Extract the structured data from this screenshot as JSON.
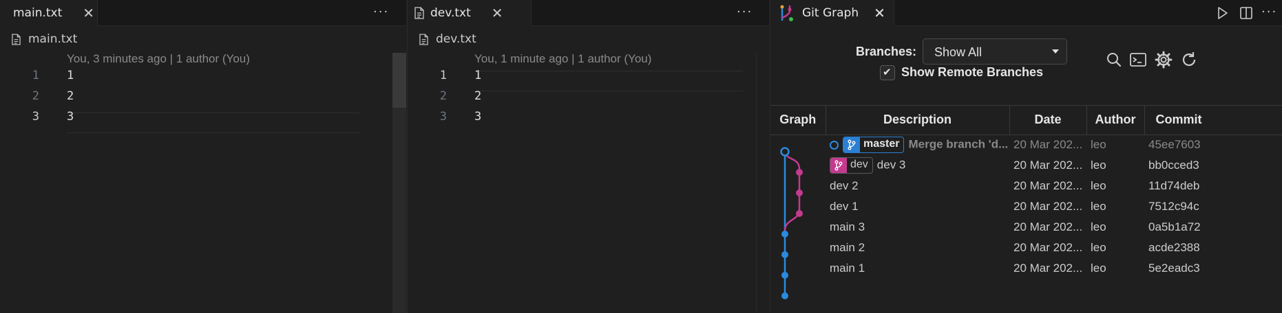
{
  "editors": [
    {
      "tab": "main.txt",
      "breadcrumb": "main.txt",
      "blame": "You, 3 minutes ago | 1 author (You)",
      "lines": [
        {
          "num": "1",
          "code": "1"
        },
        {
          "num": "2",
          "code": "2"
        },
        {
          "num": "3",
          "code": "3"
        }
      ],
      "active_line": 3
    },
    {
      "tab": "dev.txt",
      "breadcrumb": "dev.txt",
      "blame": "You, 1 minute ago | 1 author (You)",
      "lines": [
        {
          "num": "1",
          "code": "1"
        },
        {
          "num": "2",
          "code": "2"
        },
        {
          "num": "3",
          "code": "3"
        }
      ],
      "active_line": 1
    }
  ],
  "more_label": "···",
  "close_glyph": "✕",
  "git_graph": {
    "tab": "Git Graph",
    "branches_label": "Branches:",
    "branches_value": "Show All",
    "show_remote_label": "Show Remote Branches",
    "show_remote_checked": true,
    "check_glyph": "✔",
    "columns": [
      "Graph",
      "Description",
      "Date",
      "Author",
      "Commit"
    ],
    "commits": [
      {
        "refs": [
          "master"
        ],
        "head": true,
        "desc": "Merge branch 'd...",
        "date": "20 Mar 202...",
        "author": "leo",
        "hash": "45ee7603",
        "uncommitted_style": true
      },
      {
        "refs": [
          "dev"
        ],
        "head": false,
        "desc": "dev 3",
        "date": "20 Mar 202...",
        "author": "leo",
        "hash": "bb0cced3"
      },
      {
        "refs": [],
        "head": false,
        "desc": "dev 2",
        "date": "20 Mar 202...",
        "author": "leo",
        "hash": "11d74deb"
      },
      {
        "refs": [],
        "head": false,
        "desc": "dev 1",
        "date": "20 Mar 202...",
        "author": "leo",
        "hash": "7512c94c"
      },
      {
        "refs": [],
        "head": false,
        "desc": "main 3",
        "date": "20 Mar 202...",
        "author": "leo",
        "hash": "0a5b1a72"
      },
      {
        "refs": [],
        "head": false,
        "desc": "main 2",
        "date": "20 Mar 202...",
        "author": "leo",
        "hash": "acde2388"
      },
      {
        "refs": [],
        "head": false,
        "desc": "main 1",
        "date": "20 Mar 202...",
        "author": "leo",
        "hash": "5e2eadc3"
      }
    ],
    "colors": {
      "master": "#2b8adf",
      "dev": "#c43a8e"
    },
    "toolbar_icons": [
      "run-icon",
      "split-editor-icon"
    ],
    "control_icons": [
      "search-icon",
      "terminal-icon",
      "settings-icon",
      "refresh-icon"
    ]
  }
}
